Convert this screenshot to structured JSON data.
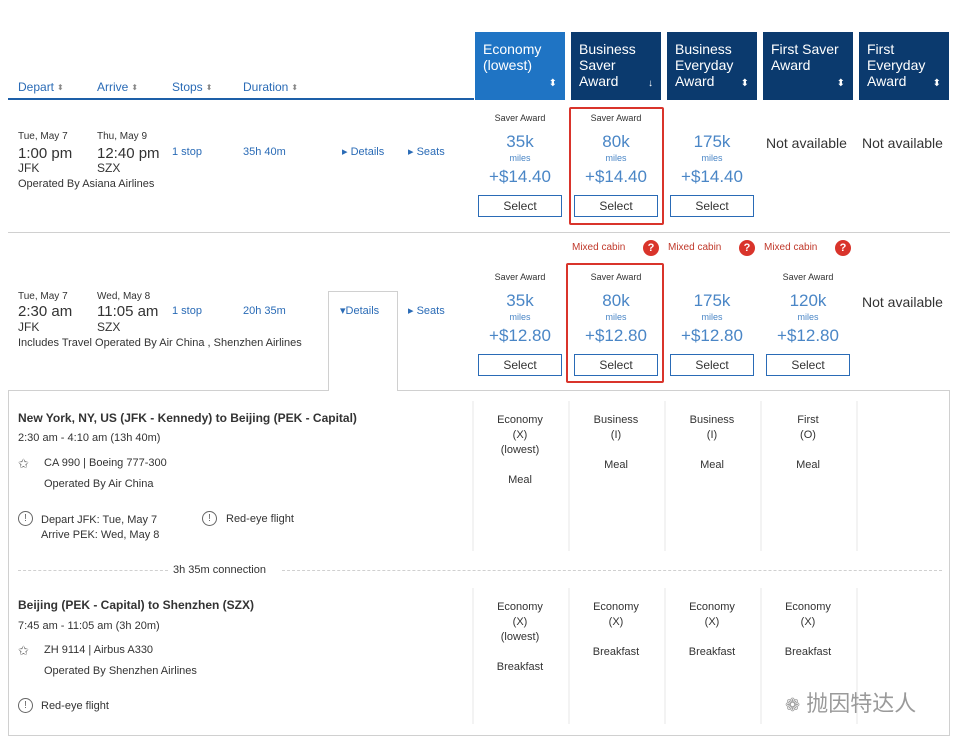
{
  "headers": {
    "depart": "Depart",
    "arrive": "Arrive",
    "stops": "Stops",
    "duration": "Duration"
  },
  "fare_columns": [
    {
      "label": "Economy (lowest)",
      "sort": "⬍"
    },
    {
      "label": "Business Saver Award",
      "sort": "↓"
    },
    {
      "label": "Business Everyday Award",
      "sort": "⬍"
    },
    {
      "label": "First Saver Award",
      "sort": "⬍"
    },
    {
      "label": "First Everyday Award",
      "sort": "⬍"
    }
  ],
  "colors": {
    "header_bg": "#0b3a6e",
    "header_active": "#1f74c4",
    "link": "#2a6bb6",
    "highlight": "#d9342b"
  },
  "flight1": {
    "depart_date": "Tue, May 7",
    "depart_time": "1:00 pm",
    "depart_code": "JFK",
    "arrive_date": "Thu, May 9",
    "arrive_time": "12:40 pm",
    "arrive_code": "SZX",
    "stops": "1 stop",
    "duration": "35h 40m",
    "details": "Details",
    "seats": "Seats",
    "operated": "Operated By Asiana Airlines",
    "fares": [
      {
        "saver": "Saver Award",
        "miles": "35k",
        "miles_label": "miles",
        "tax": "+$14.40",
        "select": "Select"
      },
      {
        "saver": "Saver Award",
        "miles": "80k",
        "miles_label": "miles",
        "tax": "+$14.40",
        "select": "Select"
      },
      {
        "saver": "",
        "miles": "175k",
        "miles_label": "miles",
        "tax": "+$14.40",
        "select": "Select"
      }
    ],
    "not_available_1": "Not available",
    "not_available_2": "Not available"
  },
  "mixed_cabin": "Mixed cabin",
  "flight2": {
    "depart_date": "Tue, May 7",
    "depart_time": "2:30 am",
    "depart_code": "JFK",
    "arrive_date": "Wed, May 8",
    "arrive_time": "11:05 am",
    "arrive_code": "SZX",
    "stops": "1 stop",
    "duration": "20h 35m",
    "details": "Details",
    "seats": "Seats",
    "operated": "Includes Travel Operated By Air China , Shenzhen Airlines",
    "fares": [
      {
        "saver": "Saver Award",
        "miles": "35k",
        "miles_label": "miles",
        "tax": "+$12.80",
        "select": "Select"
      },
      {
        "saver": "Saver Award",
        "miles": "80k",
        "miles_label": "miles",
        "tax": "+$12.80",
        "select": "Select"
      },
      {
        "saver": "",
        "miles": "175k",
        "miles_label": "miles",
        "tax": "+$12.80",
        "select": "Select"
      },
      {
        "saver": "Saver Award",
        "miles": "120k",
        "miles_label": "miles",
        "tax": "+$12.80",
        "select": "Select"
      }
    ],
    "not_available": "Not available"
  },
  "segment1": {
    "route": "New York, NY, US (JFK - Kennedy) to Beijing (PEK - Capital)",
    "times": "2:30 am - 4:10 am (13h 40m)",
    "flight": "CA 990 | Boeing 777-300",
    "operated": "Operated By Air China",
    "warn1_line1": "Depart JFK: Tue, May 7",
    "warn1_line2": "Arrive PEK: Wed, May 8",
    "warn2": "Red-eye flight",
    "cabins": [
      {
        "l1": "Economy",
        "l2": "(X)",
        "l3": "(lowest)",
        "meal": "Meal"
      },
      {
        "l1": "Business",
        "l2": "(I)",
        "l3": "",
        "meal": "Meal"
      },
      {
        "l1": "Business",
        "l2": "(I)",
        "l3": "",
        "meal": "Meal"
      },
      {
        "l1": "First",
        "l2": "(O)",
        "l3": "",
        "meal": "Meal"
      }
    ]
  },
  "connection": "3h 35m connection",
  "segment2": {
    "route": "Beijing (PEK - Capital) to Shenzhen (SZX)",
    "times": "7:45 am - 11:05 am (3h 20m)",
    "flight": "ZH 9114 | Airbus A330",
    "operated": "Operated By Shenzhen Airlines",
    "warn": "Red-eye flight",
    "cabins": [
      {
        "l1": "Economy",
        "l2": "(X)",
        "l3": "(lowest)",
        "meal": "Breakfast"
      },
      {
        "l1": "Economy",
        "l2": "(X)",
        "l3": "",
        "meal": "Breakfast"
      },
      {
        "l1": "Economy",
        "l2": "(X)",
        "l3": "",
        "meal": "Breakfast"
      },
      {
        "l1": "Economy",
        "l2": "(X)",
        "l3": "",
        "meal": "Breakfast"
      }
    ]
  },
  "watermark": "抛因特达人"
}
